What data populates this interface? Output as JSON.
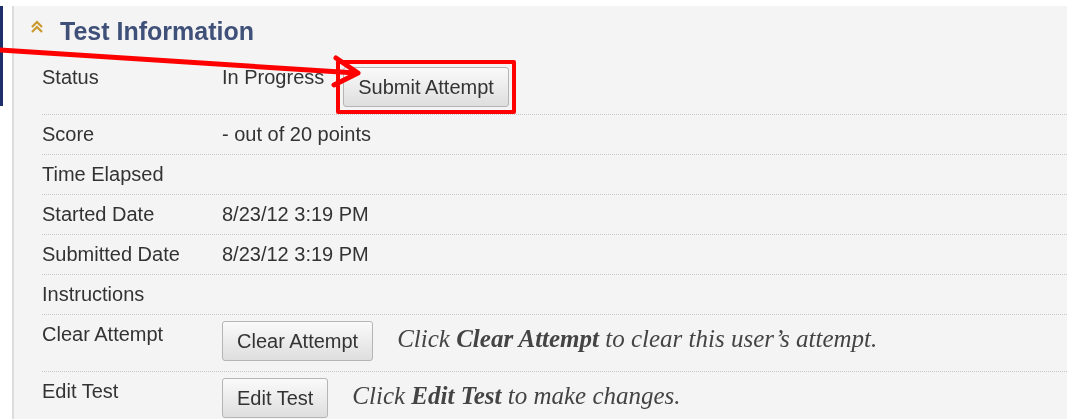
{
  "section": {
    "title": "Test Information",
    "expanded": true
  },
  "rows": [
    {
      "label": "Status",
      "value": "In Progress",
      "action": {
        "label": "Submit Attempt",
        "highlighted": true
      }
    },
    {
      "label": "Score",
      "value": "- out of 20 points"
    },
    {
      "label": "Time Elapsed"
    },
    {
      "label": "Started Date",
      "value": "8/23/12 3:19 PM"
    },
    {
      "label": "Submitted Date",
      "value": "8/23/12 3:19 PM"
    },
    {
      "label": "Instructions"
    },
    {
      "label": "Clear Attempt",
      "action": {
        "label": "Clear Attempt",
        "highlighted": false
      },
      "hint": "Click **Clear Attempt** to clear this user’s attempt."
    },
    {
      "label": "Edit Test",
      "action": {
        "label": "Edit Test",
        "highlighted": false
      },
      "hint": "Click **Edit Test** to make changes."
    }
  ]
}
